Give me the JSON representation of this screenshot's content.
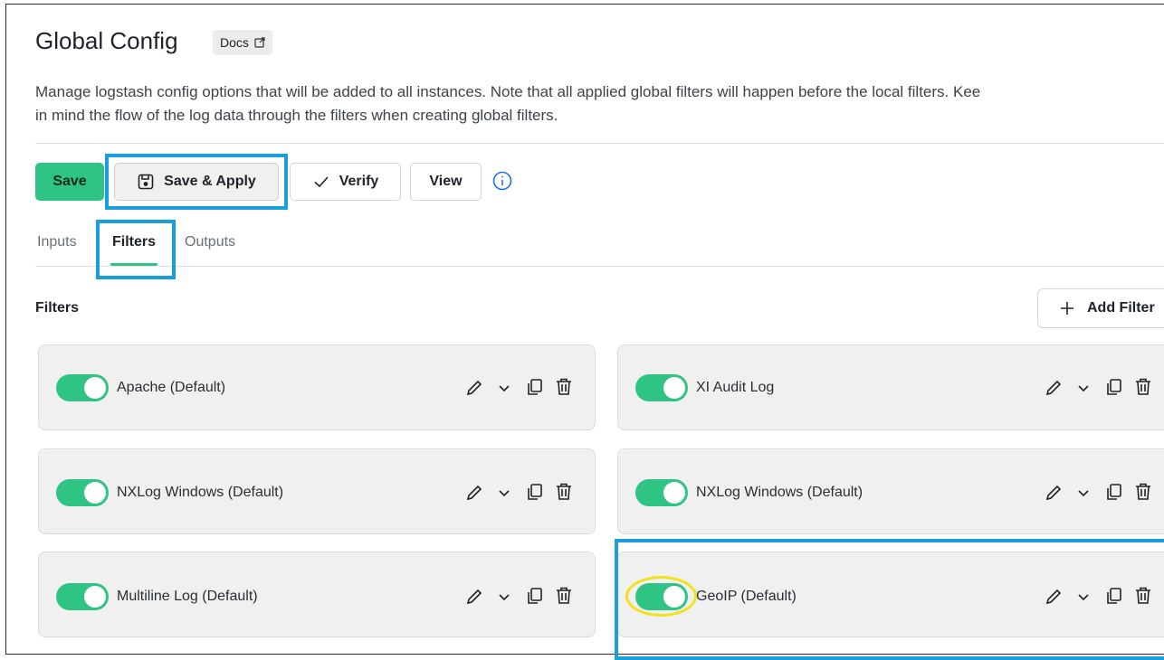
{
  "header": {
    "title": "Global Config",
    "docs_label": "Docs",
    "description": "Manage logstash config options that will be added to all instances. Note that all applied global filters will happen before the local filters. Kee\nin mind the flow of the log data through the filters when creating global filters."
  },
  "toolbar": {
    "save_label": "Save",
    "save_apply_label": "Save & Apply",
    "verify_label": "Verify",
    "view_label": "View"
  },
  "tabs": [
    {
      "label": "Inputs",
      "active": false
    },
    {
      "label": "Filters",
      "active": true
    },
    {
      "label": "Outputs",
      "active": false
    }
  ],
  "filters_section": {
    "title": "Filters",
    "add_label": "Add Filter",
    "cards": [
      {
        "label": "Apache (Default)",
        "enabled": true
      },
      {
        "label": "XI Audit Log",
        "enabled": true
      },
      {
        "label": "NXLog Windows (Default)",
        "enabled": true
      },
      {
        "label": "NXLog Windows (Default)",
        "enabled": true
      },
      {
        "label": "Multiline Log (Default)",
        "enabled": true
      },
      {
        "label": "GeoIP (Default)",
        "enabled": true
      }
    ]
  },
  "colors": {
    "accent_green": "#2fc484",
    "highlight_blue": "#1a9fdc",
    "highlight_yellow": "#f2e11c"
  }
}
